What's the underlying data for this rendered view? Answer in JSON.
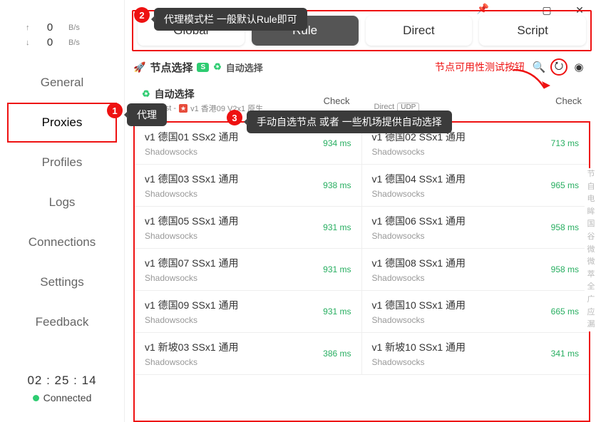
{
  "window": {
    "pin": "📌",
    "min": "—",
    "max": "▢",
    "close": "✕"
  },
  "speed": {
    "up_arrow": "↑",
    "up_val": "0",
    "up_unit": "B/s",
    "down_arrow": "↓",
    "down_val": "0",
    "down_unit": "B/s"
  },
  "nav": {
    "general": "General",
    "proxies": "Proxies",
    "profiles": "Profiles",
    "logs": "Logs",
    "connections": "Connections",
    "settings": "Settings",
    "feedback": "Feedback"
  },
  "status": {
    "timer": "02 : 25 : 14",
    "connected": "Connected"
  },
  "tabs": {
    "global": "Global",
    "rule": "Rule",
    "direct": "Direct",
    "script": "Script"
  },
  "callouts": {
    "b1_label": "代理",
    "b2_text": "代理模式栏  一般默认Rule即可",
    "b3_text": "手动自选节点 或者 一些机场提供自动选择",
    "test_label": "节点可用性测试按钮"
  },
  "group": {
    "title": "节点选择",
    "badge": "S",
    "auto_icon": "♻",
    "auto_text": "自动选择",
    "left": {
      "top_icon": "♻",
      "top_text": "自动选择",
      "sub_prefix": "URLTest - ",
      "sub_text": "v1 香港09 V2x1 原生",
      "check": "Check"
    },
    "right": {
      "top_text": "Direct",
      "udp": "UDP",
      "check": "Check"
    }
  },
  "icons": {
    "search": "🔍",
    "speed": "⭮",
    "eye": "◉"
  },
  "proxies": [
    {
      "name": "v1 德国01 SSx2 通用",
      "type": "Shadowsocks",
      "lat": "934 ms"
    },
    {
      "name": "v1 德国02 SSx1 通用",
      "type": "Shadowsocks",
      "lat": "713 ms"
    },
    {
      "name": "v1 德国03 SSx1 通用",
      "type": "Shadowsocks",
      "lat": "938 ms"
    },
    {
      "name": "v1 德国04 SSx1 通用",
      "type": "Shadowsocks",
      "lat": "965 ms"
    },
    {
      "name": "v1 德国05 SSx1 通用",
      "type": "Shadowsocks",
      "lat": "931 ms"
    },
    {
      "name": "v1 德国06 SSx1 通用",
      "type": "Shadowsocks",
      "lat": "958 ms"
    },
    {
      "name": "v1 德国07 SSx1 通用",
      "type": "Shadowsocks",
      "lat": "931 ms"
    },
    {
      "name": "v1 德国08 SSx1 通用",
      "type": "Shadowsocks",
      "lat": "958 ms"
    },
    {
      "name": "v1 德国09 SSx1 通用",
      "type": "Shadowsocks",
      "lat": "931 ms"
    },
    {
      "name": "v1 德国10 SSx1 通用",
      "type": "Shadowsocks",
      "lat": "665 ms"
    },
    {
      "name": "v1 新坡03 SSx1 通用",
      "type": "Shadowsocks",
      "lat": "386 ms"
    },
    {
      "name": "v1 新坡10 SSx1 通用",
      "type": "Shadowsocks",
      "lat": "341 ms"
    }
  ],
  "right_strip": "节自电眸国谷微微萃全广应漏"
}
